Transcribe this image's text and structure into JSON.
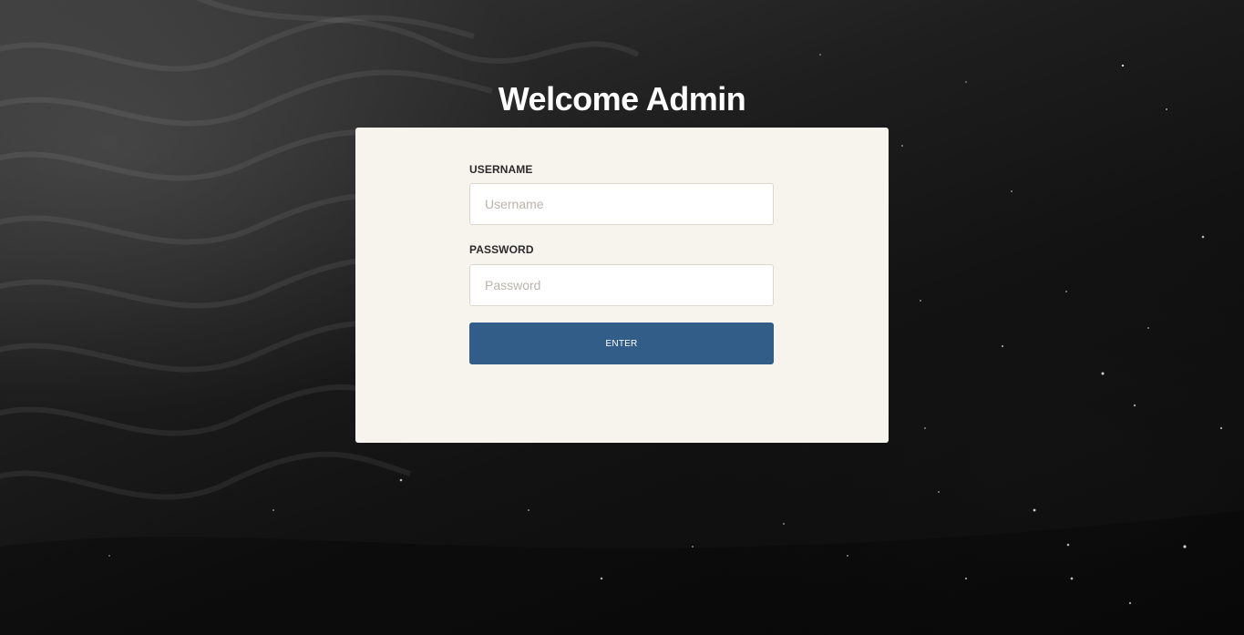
{
  "page": {
    "heading": "Welcome Admin"
  },
  "form": {
    "username_label": "USERNAME",
    "username_placeholder": "Username",
    "username_value": "",
    "password_label": "PASSWORD",
    "password_placeholder": "Password",
    "password_value": "",
    "submit_label": "ENTER"
  },
  "colors": {
    "card_background": "#f7f4ee",
    "button_background": "#325d88",
    "button_text": "#ffffff",
    "heading_text": "#ffffff",
    "page_background": "#111111"
  }
}
